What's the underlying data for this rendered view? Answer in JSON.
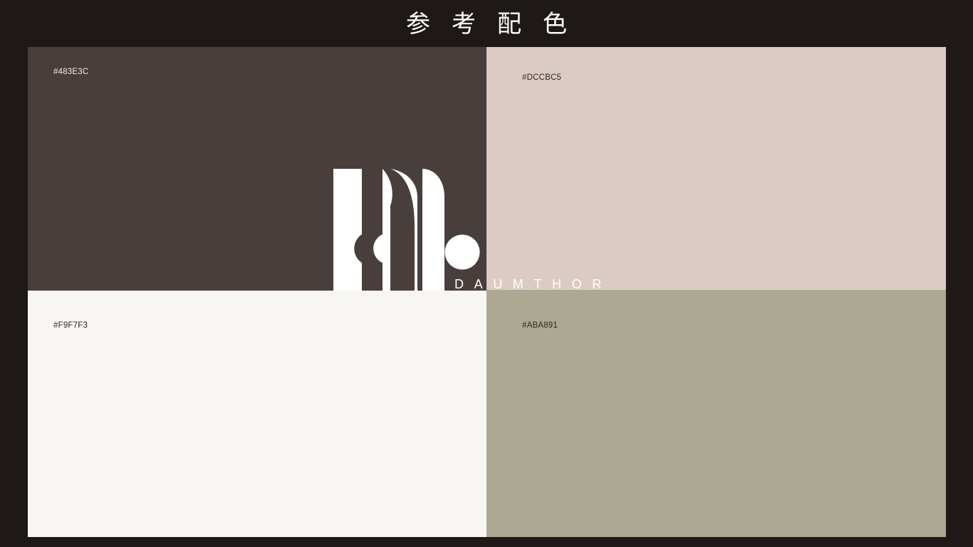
{
  "page": {
    "title": "参考配色",
    "background": "#1E1917"
  },
  "swatches": [
    {
      "code": "#483E3C",
      "color": "#483E3C",
      "text_color": "#F2ECEA"
    },
    {
      "code": "#DCCBC5",
      "color": "#DCCBC5",
      "text_color": "#2E2624"
    },
    {
      "code": "#F9F7F3",
      "color": "#F7F6F2",
      "text_color": "#2E2624"
    },
    {
      "code": "#ABA891",
      "color": "#ACA891",
      "text_color": "#2E2624"
    }
  ],
  "logo": {
    "brand_name": "DAUMTHOR",
    "color": "#FFFFFF",
    "icon": "stylized-d-and-b-monogram"
  }
}
